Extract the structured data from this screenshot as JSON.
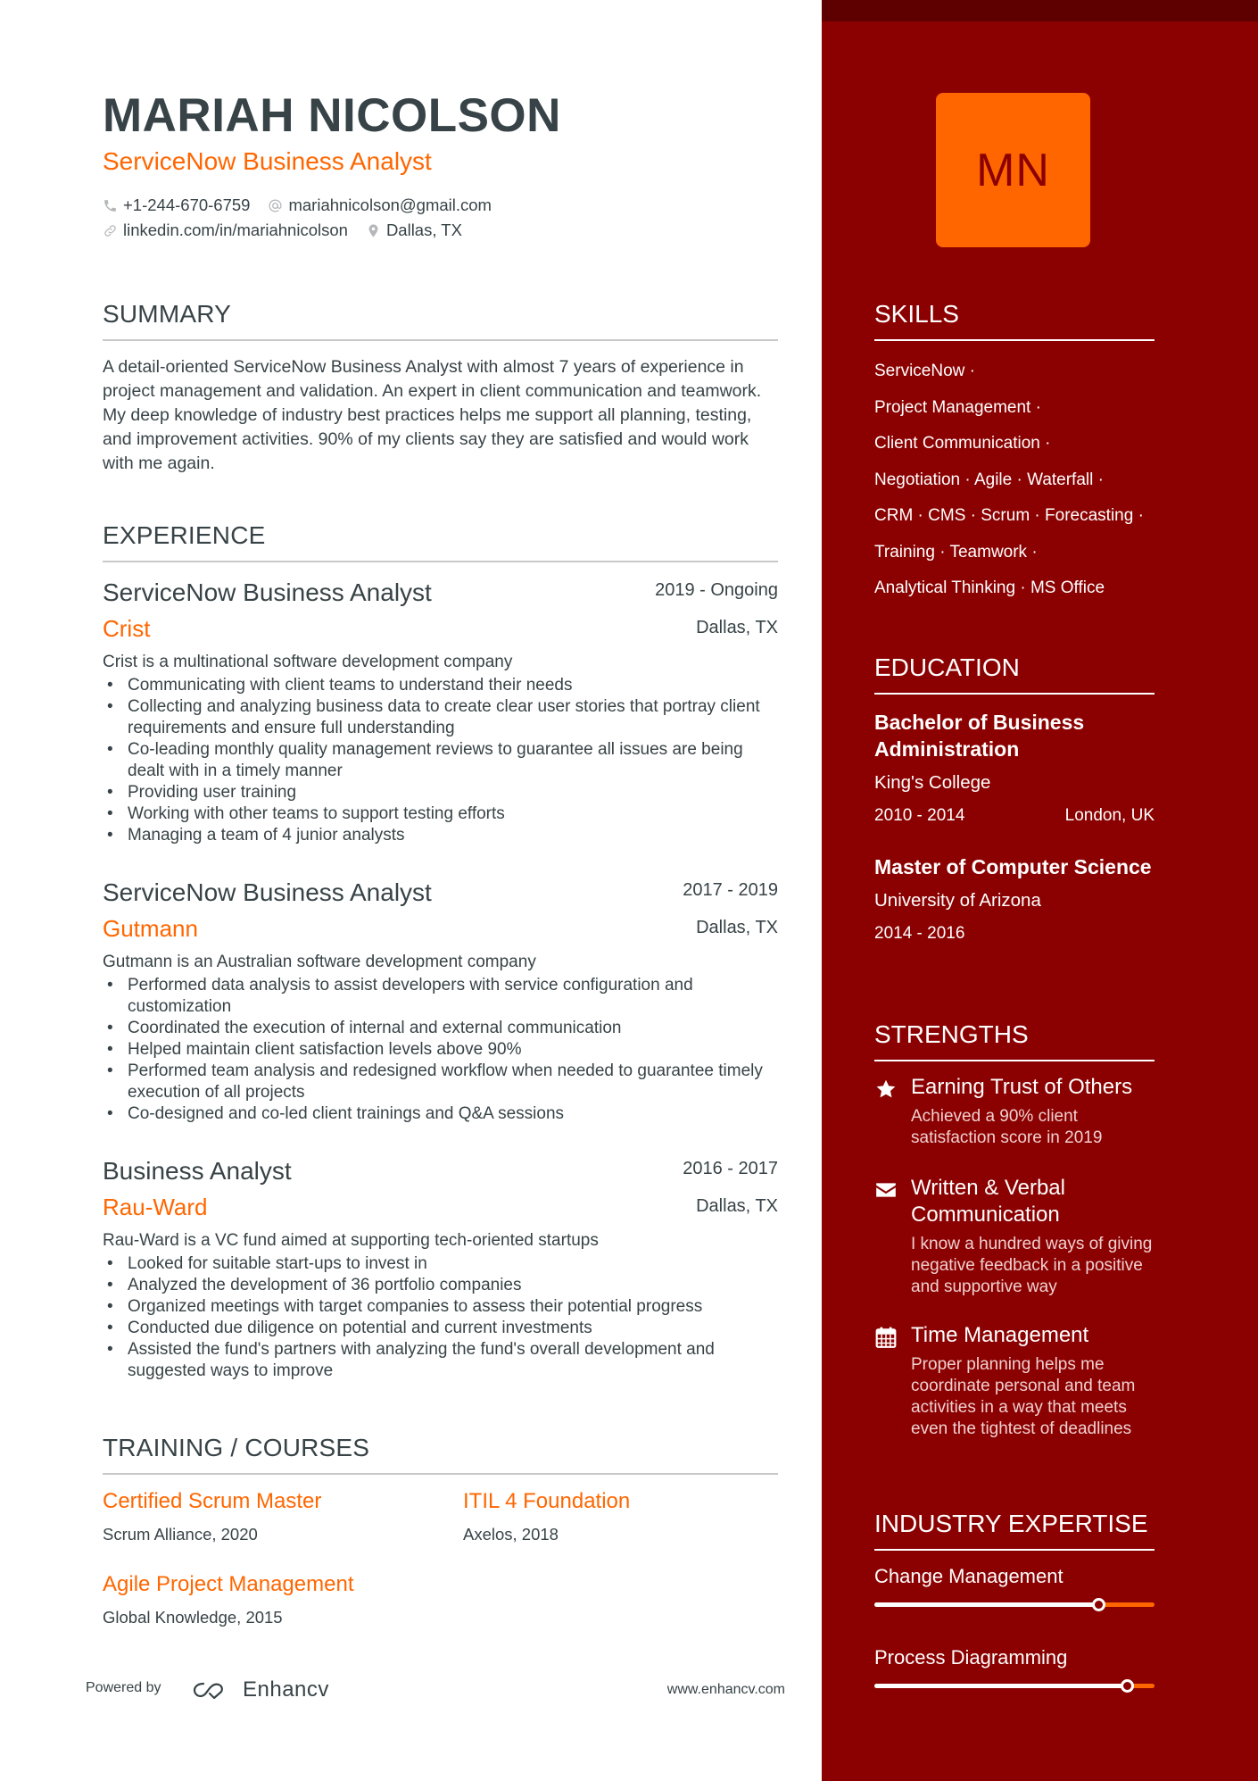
{
  "header": {
    "name": "MARIAH NICOLSON",
    "title": "ServiceNow Business Analyst",
    "phone": "+1-244-670-6759",
    "email": "mariahnicolson@gmail.com",
    "linkedin": "linkedin.com/in/mariahnicolson",
    "location": "Dallas, TX",
    "icons": {
      "phone": "phone-icon",
      "email": "at-icon",
      "linkedin": "link-icon",
      "location": "map-pin-icon"
    }
  },
  "summary": {
    "heading": "SUMMARY",
    "text": "A detail-oriented ServiceNow Business Analyst with almost 7 years of experience in project management and validation. An expert in client communication and teamwork. My deep knowledge of industry best practices helps me support all planning, testing, and improvement activities. 90% of my clients say they are satisfied and would work with me again."
  },
  "experience": {
    "heading": "EXPERIENCE",
    "jobs": [
      {
        "role": "ServiceNow Business Analyst",
        "dates": "2019 - Ongoing",
        "company": "Crist",
        "location": "Dallas, TX",
        "description": "Crist is a multinational software development company",
        "bullets": [
          "Communicating with client teams to understand their needs",
          "Collecting and analyzing business data to create clear user stories that portray client requirements and ensure full understanding",
          "Co-leading monthly quality management reviews to guarantee all issues are being dealt with in a timely manner",
          "Providing user training",
          "Working with other teams to support testing efforts",
          "Managing a team of 4 junior analysts"
        ]
      },
      {
        "role": "ServiceNow Business Analyst",
        "dates": "2017 - 2019",
        "company": "Gutmann",
        "location": "Dallas, TX",
        "description": "Gutmann is an Australian software development company",
        "bullets": [
          "Performed data analysis to assist developers with service configuration and customization",
          "Coordinated the execution of internal and external communication",
          "Helped maintain client satisfaction levels above 90%",
          "Performed team analysis and redesigned workflow when needed to guarantee timely execution of all projects",
          "Co-designed and co-led client trainings and Q&A sessions"
        ]
      },
      {
        "role": "Business Analyst",
        "dates": "2016 - 2017",
        "company": "Rau-Ward",
        "location": "Dallas, TX",
        "description": "Rau-Ward is a VC fund aimed at supporting tech-oriented startups",
        "bullets": [
          "Looked for suitable start-ups to invest in",
          "Analyzed the development of 36 portfolio companies",
          "Organized meetings with target companies to assess their potential progress",
          "Conducted due diligence on potential and current investments",
          "Assisted the fund's partners with analyzing the fund's overall development and suggested ways to improve"
        ]
      }
    ]
  },
  "training": {
    "heading": "TRAINING / COURSES",
    "courses": [
      {
        "name": "Certified Scrum Master",
        "org": "Scrum Alliance, 2020"
      },
      {
        "name": "ITIL 4 Foundation",
        "org": "Axelos, 2018"
      },
      {
        "name": "Agile Project Management",
        "org": "Global Knowledge, 2015"
      }
    ]
  },
  "footer": {
    "powered_by": "Powered by",
    "brand": "Enhancv",
    "website": "www.enhancv.com"
  },
  "sidebar": {
    "avatar_initials": "MN",
    "skills": {
      "heading": "SKILLS",
      "lines": [
        "ServiceNow ·",
        "Project Management ·",
        "Client Communication ·",
        "Negotiation · Agile · Waterfall ·",
        "CRM · CMS · Scrum · Forecasting ·",
        "Training · Teamwork ·",
        "Analytical Thinking · MS Office"
      ]
    },
    "education": {
      "heading": "EDUCATION",
      "entries": [
        {
          "degree": "Bachelor of Business Administration",
          "school": "King's College",
          "dates": "2010 - 2014",
          "location": "London, UK"
        },
        {
          "degree": "Master of Computer Science",
          "school": "University of Arizona",
          "dates": "2014 - 2016",
          "location": ""
        }
      ]
    },
    "strengths": {
      "heading": "STRENGTHS",
      "items": [
        {
          "icon": "star-icon",
          "title": "Earning Trust of Others",
          "description": "Achieved a 90% client satisfaction score in 2019"
        },
        {
          "icon": "envelope-icon",
          "title": "Written & Verbal Communication",
          "description": "I know a hundred ways of giving negative feedback in a positive and supportive way"
        },
        {
          "icon": "calendar-icon",
          "title": "Time Management",
          "description": "Proper planning helps me coordinate personal and team activities in a way that meets even the tightest of deadlines"
        }
      ]
    },
    "expertise": {
      "heading": "INDUSTRY EXPERTISE",
      "items": [
        {
          "label": "Change Management",
          "level_percent": 80
        },
        {
          "label": "Process Diagramming",
          "level_percent": 90
        }
      ]
    }
  },
  "colors": {
    "accent": "#ff6600",
    "sidebar_bg": "#8b0000",
    "sidebar_topbar": "#5f0000",
    "text": "#384347"
  }
}
